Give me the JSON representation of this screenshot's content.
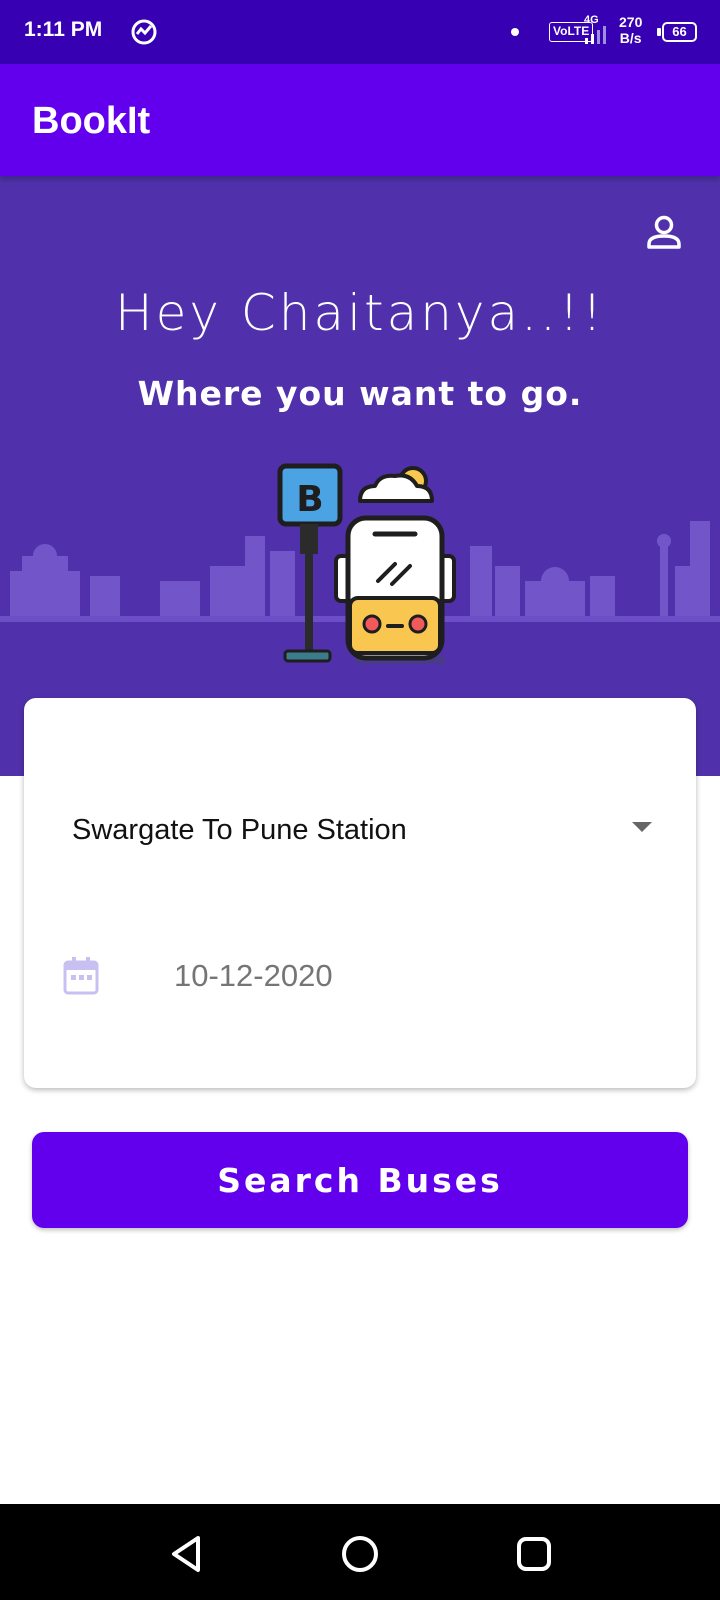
{
  "status_bar": {
    "time": "1:11 PM",
    "volte": "VoLTE",
    "network": "4G",
    "speed_value": "270",
    "speed_unit": "B/s",
    "battery": "66"
  },
  "app_bar": {
    "title": "BookIt"
  },
  "hero": {
    "greeting": "Hey Chaitanya..!!",
    "subtitle": "Where you want to go.",
    "bus_stop_sign": "B"
  },
  "form": {
    "route_value": "Swargate To Pune Station",
    "date_value": "10-12-2020"
  },
  "search_button": {
    "label": "Search Buses"
  },
  "colors": {
    "status_bar": "#3700b3",
    "app_bar": "#6200ee",
    "hero_bg": "#5031ab",
    "button": "#6200ee",
    "bus_body": "#ffffff",
    "bus_front": "#f9c74f",
    "sign": "#4ba3e3"
  },
  "icons": {
    "profile": "person-outline-icon",
    "calendar": "calendar-icon",
    "dropdown": "dropdown-arrow-icon",
    "back": "back-triangle-icon",
    "home": "home-circle-icon",
    "recents": "recents-square-icon"
  }
}
